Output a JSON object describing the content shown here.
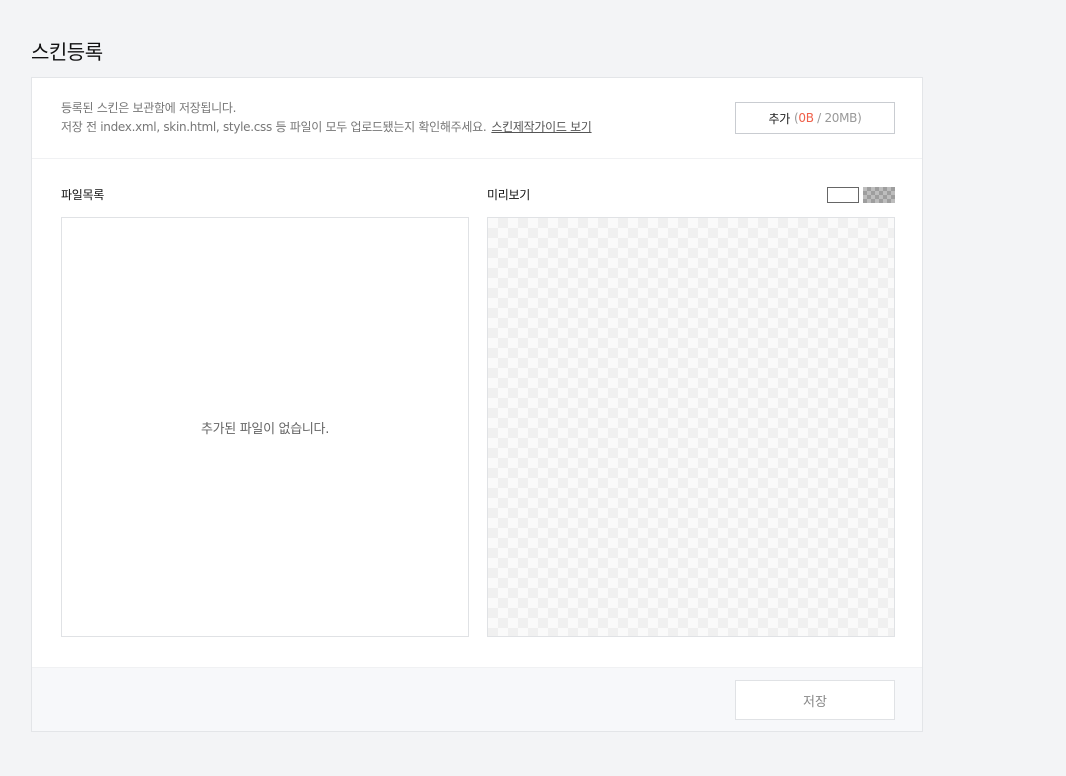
{
  "page": {
    "title": "스킨등록"
  },
  "info": {
    "line1": "등록된 스킨은 보관함에 저장됩니다.",
    "line2": "저장 전 index.xml, skin.html, style.css 등 파일이 모두 업로드됐는지 확인해주세요.",
    "guide_link": "스킨제작가이드 보기"
  },
  "add_button": {
    "label": "추가",
    "open_paren": "(",
    "used": "0B",
    "separator": " / ",
    "limit": "20MB",
    "close_paren": ")",
    "used_color": "#f0604a"
  },
  "file_list": {
    "label": "파일목록",
    "empty_message": "추가된 파일이 없습니다."
  },
  "preview": {
    "label": "미리보기",
    "bg_options": [
      "white-background",
      "checker-background"
    ]
  },
  "footer": {
    "save_label": "저장"
  }
}
